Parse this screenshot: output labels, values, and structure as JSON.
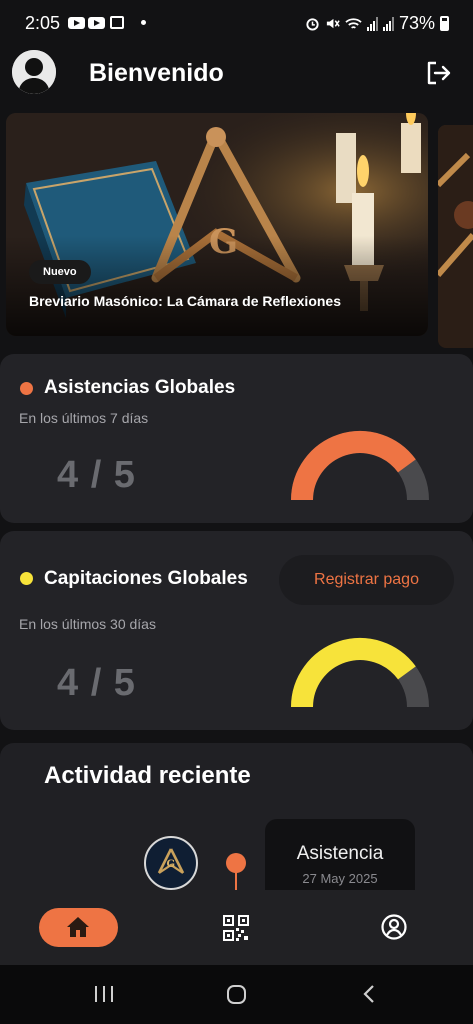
{
  "status_bar": {
    "time": "2:05",
    "battery": "73%"
  },
  "header": {
    "title": "Bienvenido"
  },
  "carousel": {
    "items": [
      {
        "badge": "Nuevo",
        "title": "Breviario Masónico: La Cámara de Reflexiones"
      }
    ]
  },
  "stats": [
    {
      "title": "Asistencias Globales",
      "subtitle": "En los últimos 7 días",
      "value": "4 / 5",
      "fraction": 0.8,
      "color": "#ee7444"
    },
    {
      "title": "Capitaciones Globales",
      "subtitle": "En los últimos 30 días",
      "value": "4 / 5",
      "fraction": 0.8,
      "color": "#f7e33a",
      "action": "Registrar pago"
    }
  ],
  "activity": {
    "title": "Actividad reciente",
    "items": [
      {
        "type": "Asistencia",
        "date": "27 May 2025"
      }
    ]
  },
  "colors": {
    "accent": "#ee7444",
    "secondary": "#f7e33a",
    "card": "#232327",
    "gauge_track": "#4a4a4d"
  },
  "icons": {
    "avatar": "user-avatar-icon",
    "logout": "logout-icon",
    "home": "home-icon",
    "qr": "qr-code-icon",
    "profile": "profile-icon"
  }
}
